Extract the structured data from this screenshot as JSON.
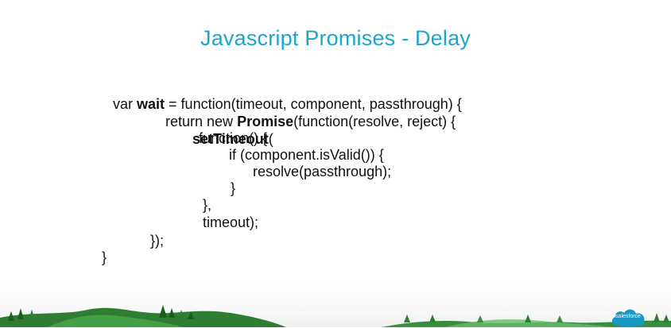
{
  "slide": {
    "title": "Javascript Promises - Delay"
  },
  "code": {
    "l1_a": "var ",
    "l1_b": "wait",
    "l1_c": " = function(timeout, component, passthrough) {",
    "l2_a": "return new ",
    "l2_b": "Promise",
    "l2_c": "(function(resolve, reject) {",
    "l3_a": "setTimeout",
    "l3_b": "(",
    "l4": "function() {",
    "l5": "if (component.isValid()) {",
    "l6": "resolve(passthrough);",
    "l7": "}",
    "l8": "},",
    "l9": "timeout);",
    "l10": "});",
    "l11": "}"
  },
  "branding": {
    "logo_text": "salesforce",
    "logo_color": "#1798c1"
  },
  "colors": {
    "title": "#1aa6cd",
    "grass_dark": "#2e7d32",
    "grass_light": "#43a047"
  }
}
